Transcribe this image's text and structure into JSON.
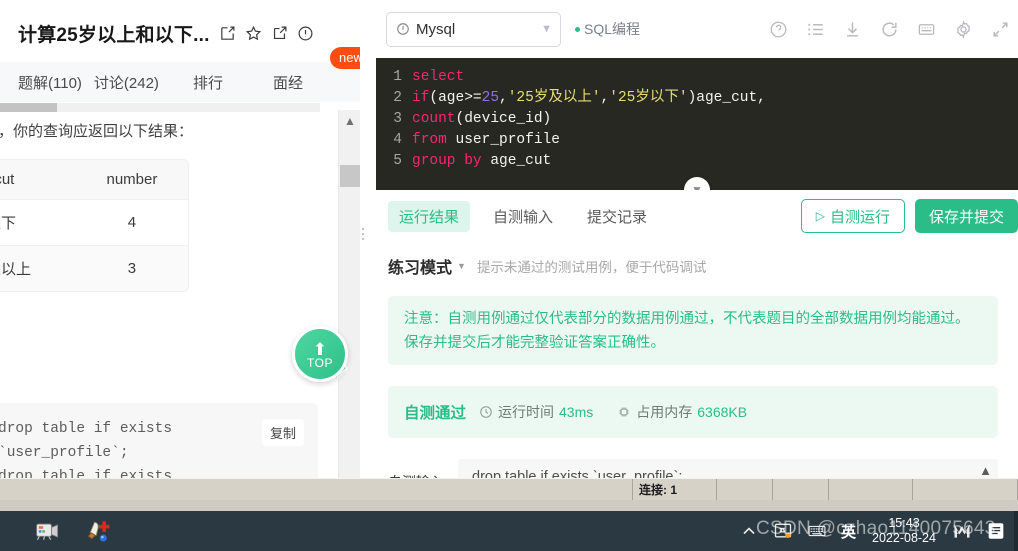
{
  "problem": {
    "title": "计算25岁以上和以下...",
    "icons": [
      "edit-icon",
      "star-icon",
      "share-icon",
      "info-icon"
    ],
    "tabs": [
      {
        "label": "题解(110)"
      },
      {
        "label": "讨论(242)"
      },
      {
        "label": "排行"
      },
      {
        "label": "面经"
      }
    ],
    "new_badge": "new"
  },
  "description": {
    "lead": "，你的查询应返回以下结果：",
    "table": {
      "headers": [
        "_cut",
        "number"
      ],
      "rows": [
        [
          "以下",
          "4"
        ],
        [
          "及以上",
          "3"
        ]
      ]
    },
    "code_snippet": "drop table if exists\n`user_profile`;\ndrop table if exists",
    "copy_label": "复制"
  },
  "scroll_top_button": {
    "label": "TOP"
  },
  "editor": {
    "db_engine": "Mysql",
    "mode_label": "SQL编程",
    "toolbar_icons": [
      "help-icon",
      "list-icon",
      "download-icon",
      "refresh-icon",
      "keyboard-icon",
      "settings-icon",
      "fullscreen-icon"
    ],
    "code_lines": [
      {
        "n": "1",
        "tokens": [
          {
            "t": "select",
            "c": "kw"
          }
        ]
      },
      {
        "n": "2",
        "tokens": [
          {
            "t": "if",
            "c": "kw"
          },
          {
            "t": "(age>=",
            "c": "idn"
          },
          {
            "t": "25",
            "c": "num"
          },
          {
            "t": ",",
            "c": "idn"
          },
          {
            "t": "'25岁及以上'",
            "c": "str"
          },
          {
            "t": ",",
            "c": "idn"
          },
          {
            "t": "'25岁以下'",
            "c": "str"
          },
          {
            "t": ")age_cut,",
            "c": "idn"
          }
        ]
      },
      {
        "n": "3",
        "tokens": [
          {
            "t": "count",
            "c": "kw"
          },
          {
            "t": "(device_id)",
            "c": "idn"
          }
        ]
      },
      {
        "n": "4",
        "tokens": [
          {
            "t": "from",
            "c": "kw"
          },
          {
            "t": " user_profile",
            "c": "idn"
          }
        ]
      },
      {
        "n": "5",
        "tokens": [
          {
            "t": "group by",
            "c": "kw"
          },
          {
            "t": " age_cut",
            "c": "idn"
          }
        ]
      }
    ]
  },
  "result_panel": {
    "tabs": [
      {
        "label": "运行结果",
        "active": true
      },
      {
        "label": "自测输入",
        "active": false
      },
      {
        "label": "提交记录",
        "active": false
      }
    ],
    "run_button": "自测运行",
    "submit_button": "保存并提交",
    "mode_name": "练习模式",
    "mode_hint": "提示未通过的测试用例，便于代码调试",
    "notice": "注意：自测用例通过仅代表部分的数据用例通过，不代表题目的全部数据用例均能通过。保存并提交后才能完整验证答案正确性。",
    "pass_label": "自测通过",
    "time_key": "运行时间",
    "time_value": "43ms",
    "memory_key": "占用内存",
    "memory_value": "6368KB",
    "input_label": "自测输入",
    "input_text": "drop table if exists `user_profile`;"
  },
  "status_strip": {
    "connection": "连接: 1"
  },
  "taskbar": {
    "ime": "英",
    "time": "15:43",
    "date": "2022-08-24",
    "icons": [
      "chevron-up-icon",
      "screenshot-icon",
      "keyboard-icon",
      "m-icon",
      "notification-icon"
    ],
    "watermark": "CSDN @czhao1140075643"
  },
  "colors": {
    "accent_green": "#2bbd87",
    "badge_orange": "#ff4d12",
    "editor_bg": "#272822",
    "taskbar_bg": "#2b3a42"
  }
}
